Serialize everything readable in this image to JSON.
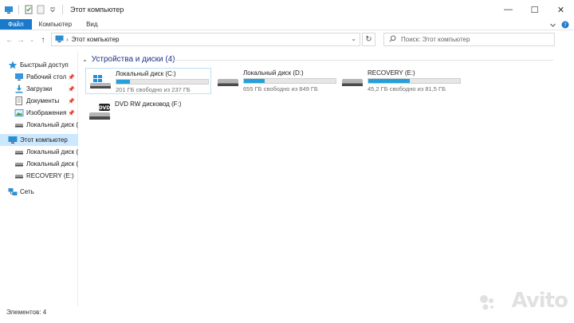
{
  "window": {
    "title": "Этот компьютер",
    "controls": {
      "minimize": "—",
      "maximize": "☐",
      "close": "✕"
    }
  },
  "ribbon": {
    "tabs": [
      "Файл",
      "Компьютер",
      "Вид"
    ],
    "expand_icon": "chevron-down-icon",
    "help_icon": "help-icon"
  },
  "addressbar": {
    "back_icon": "arrow-left-icon",
    "forward_icon": "arrow-right-icon",
    "recent_icon": "chevron-down-icon",
    "up_icon": "arrow-up-icon",
    "path": [
      "Этот компьютер"
    ],
    "search_placeholder": "Поиск: Этот компьютер"
  },
  "navpane": {
    "items": [
      {
        "label": "Быстрый доступ",
        "icon": "star-icon",
        "pinned": false
      },
      {
        "label": "Рабочий стол",
        "icon": "desktop-icon",
        "pinned": true
      },
      {
        "label": "Загрузки",
        "icon": "download-icon",
        "pinned": true
      },
      {
        "label": "Документы",
        "icon": "documents-icon",
        "pinned": true
      },
      {
        "label": "Изображения",
        "icon": "pictures-icon",
        "pinned": true
      },
      {
        "label": "Локальный диск (D",
        "icon": "drive-icon",
        "pinned": false
      },
      {
        "label": "Этот компьютер",
        "icon": "computer-icon",
        "pinned": false,
        "selected": true
      },
      {
        "label": "Локальный диск (C",
        "icon": "drive-icon",
        "pinned": false
      },
      {
        "label": "Локальный диск (D",
        "icon": "drive-icon",
        "pinned": false
      },
      {
        "label": "RECOVERY (E:)",
        "icon": "drive-icon",
        "pinned": false
      },
      {
        "label": "Сеть",
        "icon": "network-icon",
        "pinned": false
      }
    ]
  },
  "main": {
    "group_title": "Устройства и диски (4)",
    "drives": [
      {
        "name": "Локальный диск (C:)",
        "free_text": "201 ГБ свободно из 237 ГБ",
        "used_fraction": 0.15,
        "icon": "windows-drive-icon",
        "selected": true
      },
      {
        "name": "Локальный диск (D:)",
        "free_text": "655 ГБ свободно из 849 ГБ",
        "used_fraction": 0.23,
        "icon": "drive-icon",
        "selected": false
      },
      {
        "name": "RECOVERY (E:)",
        "free_text": "45,2 ГБ свободно из 81,5 ГБ",
        "used_fraction": 0.45,
        "icon": "drive-icon",
        "selected": false
      },
      {
        "name": "DVD RW дисковод (F:)",
        "icon": "dvd-drive-icon",
        "icon_label": "DVD",
        "selected": false
      }
    ]
  },
  "statusbar": {
    "items_count": "Элементов: 4"
  },
  "watermark": {
    "text": "Avito"
  },
  "colors": {
    "accent": "#1979ca",
    "bar_fill": "#26a0da",
    "selection": "#cce8ff",
    "group_title": "#1e3287"
  }
}
